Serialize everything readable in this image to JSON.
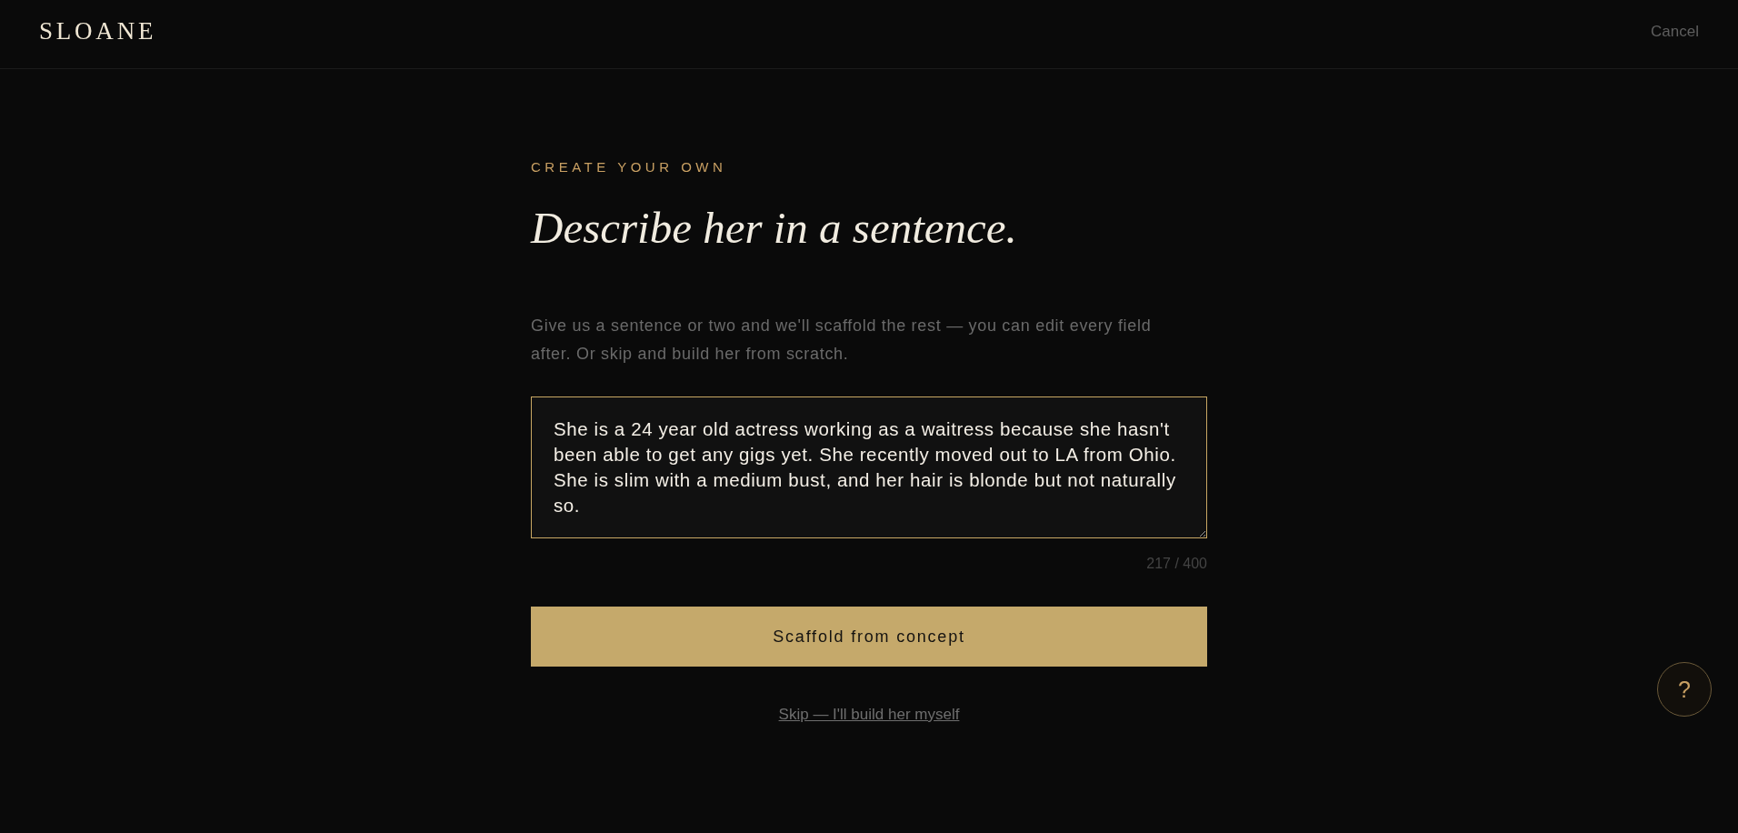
{
  "header": {
    "logo": "SLOANE",
    "cancel": "Cancel"
  },
  "main": {
    "eyebrow": "CREATE YOUR OWN",
    "title": "Describe her in a sentence.",
    "description": "Give us a sentence or two and we'll scaffold the rest — you can edit every field after. Or skip and build her from scratch.",
    "concept_field": {
      "value": "She is a 24 year old actress working as a waitress because she hasn't been able to get any gigs yet. She recently moved out to LA from Ohio. She is slim with a medium bust, and her hair is blonde but not naturally so.",
      "focused": true,
      "counter": "217 / 400"
    },
    "primary_button": "Scaffold from concept",
    "skip_link": "Skip — I'll build her myself"
  },
  "help_button": {
    "label": "?"
  }
}
